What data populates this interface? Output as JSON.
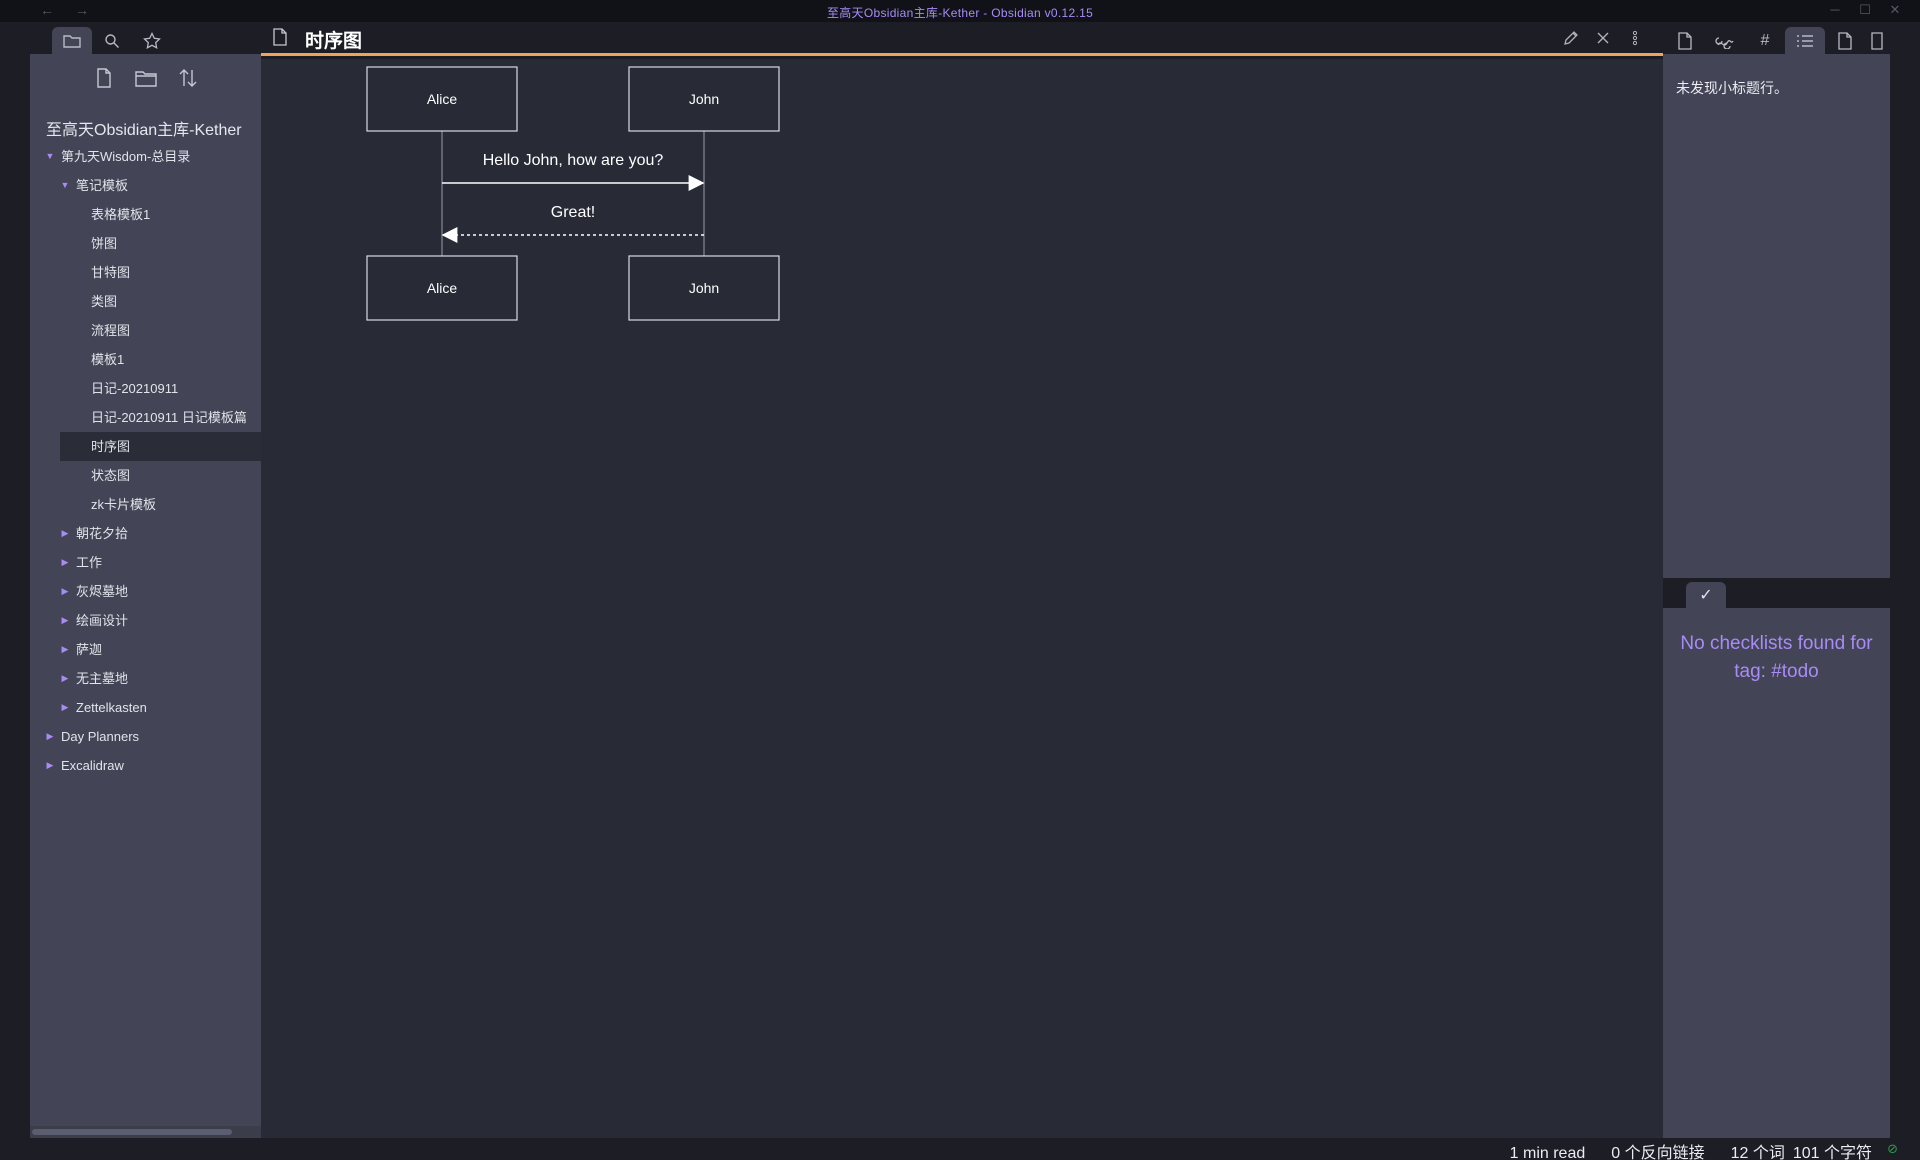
{
  "window": {
    "title": "至高天Obsidian主库-Kether - Obsidian v0.12.15",
    "back_glyph": "←",
    "forward_glyph": "→",
    "controls": [
      "─",
      "☐",
      "✕"
    ]
  },
  "left_tabs": [
    {
      "icon": "folder-icon",
      "active": true
    },
    {
      "icon": "search-icon",
      "active": false
    },
    {
      "icon": "star-icon",
      "active": false
    }
  ],
  "left_actions": [
    "new-note-icon",
    "new-folder-icon",
    "sort-icon"
  ],
  "vault": {
    "name": "至高天Obsidian主库-Kether"
  },
  "tree": [
    {
      "label": "第九天Wisdom-总目录",
      "depth": 0,
      "arrow": "▼"
    },
    {
      "label": "笔记模板",
      "depth": 1,
      "arrow": "▼"
    },
    {
      "label": "表格模板1",
      "depth": 2,
      "arrow": ""
    },
    {
      "label": "饼图",
      "depth": 2,
      "arrow": ""
    },
    {
      "label": "甘特图",
      "depth": 2,
      "arrow": ""
    },
    {
      "label": "类图",
      "depth": 2,
      "arrow": ""
    },
    {
      "label": "流程图",
      "depth": 2,
      "arrow": ""
    },
    {
      "label": "模板1",
      "depth": 2,
      "arrow": ""
    },
    {
      "label": "日记-20210911",
      "depth": 2,
      "arrow": ""
    },
    {
      "label": "日记-20210911 日记模板篇",
      "depth": 2,
      "arrow": ""
    },
    {
      "label": "时序图",
      "depth": 2,
      "arrow": "",
      "active": true
    },
    {
      "label": "状态图",
      "depth": 2,
      "arrow": ""
    },
    {
      "label": "zk卡片模板",
      "depth": 2,
      "arrow": ""
    },
    {
      "label": "朝花夕拾",
      "depth": 1,
      "arrow": "▶"
    },
    {
      "label": "工作",
      "depth": 1,
      "arrow": "▶"
    },
    {
      "label": "灰烬墓地",
      "depth": 1,
      "arrow": "▶"
    },
    {
      "label": "绘画设计",
      "depth": 1,
      "arrow": "▶"
    },
    {
      "label": "萨迦",
      "depth": 1,
      "arrow": "▶"
    },
    {
      "label": "无主墓地",
      "depth": 1,
      "arrow": "▶"
    },
    {
      "label": "Zettelkasten",
      "depth": 1,
      "arrow": "▶"
    },
    {
      "label": "Day Planners",
      "depth": 0,
      "arrow": "▶"
    },
    {
      "label": "Excalidraw",
      "depth": 0,
      "arrow": "▶"
    }
  ],
  "editor": {
    "title": "时序图",
    "header_actions": [
      "edit-icon",
      "close-icon",
      "more-options-icon"
    ]
  },
  "sequence": {
    "participants": [
      "Alice",
      "John"
    ],
    "messages": [
      {
        "from": "Alice",
        "to": "John",
        "text": "Hello John, how are you?",
        "style": "solid"
      },
      {
        "from": "John",
        "to": "Alice",
        "text": "Great!",
        "style": "dotted"
      }
    ]
  },
  "right_tabs": [
    {
      "icon": "file-icon",
      "active": false
    },
    {
      "icon": "link-icon",
      "active": false
    },
    {
      "icon": "tag-icon",
      "active": false
    },
    {
      "icon": "outline-icon",
      "active": true
    },
    {
      "icon": "page-icon",
      "active": false
    },
    {
      "icon": "bookmark-icon",
      "active": false
    }
  ],
  "outline": {
    "empty_text": "未发现小标题行。"
  },
  "checklist": {
    "tab_glyph": "✓",
    "empty_text": "No checklists found for tag: #todo"
  },
  "status": {
    "read_time": "1 min read",
    "backlinks": "0 个反向链接",
    "words": "12 个词",
    "chars": "101 个字符",
    "sync_glyph": "⊘"
  },
  "colors": {
    "accent": "#a88bf5",
    "header_underline": "#f0a35a",
    "sidebar_bg": "#434556",
    "editor_bg": "#282a36"
  }
}
